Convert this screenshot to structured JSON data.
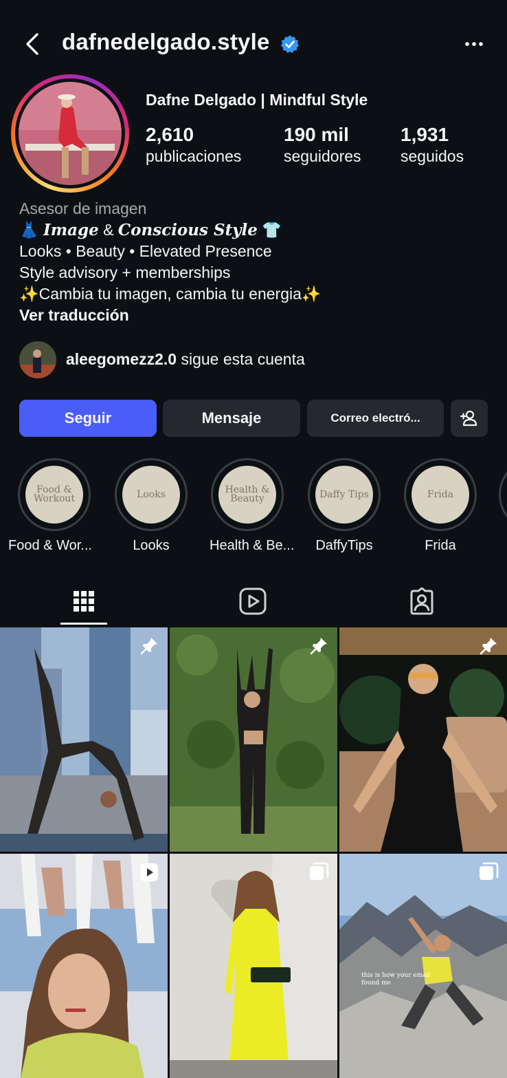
{
  "header": {
    "username": "dafnedelgado.style",
    "verified": true,
    "back_icon": "chevron-left-icon",
    "more_icon": "more-horizontal-icon"
  },
  "profile": {
    "display_name": "Dafne Delgado | Mindful Style",
    "stats": [
      {
        "value": "2,610",
        "label": "publicaciones"
      },
      {
        "value": "190 mil",
        "label": "seguidores"
      },
      {
        "value": "1,931",
        "label": "seguidos"
      }
    ]
  },
  "bio": {
    "category": "Asesor de imagen",
    "line1_emoji_left": "👗",
    "line1_word1": "Image",
    "line1_amp": " & ",
    "line1_word2": "Conscious Style",
    "line1_emoji_right": "👕",
    "line2": "Looks • Beauty • Elevated Presence",
    "line3": "Style advisory + memberships",
    "line4": "✨Cambia tu imagen, cambia tu energia✨",
    "translate": "Ver traducción"
  },
  "followed_by": {
    "username": "aleegomezz2.0",
    "suffix": " sigue esta cuenta"
  },
  "buttons": {
    "follow": "Seguir",
    "message": "Mensaje",
    "email": "Correo electró...",
    "add_user_icon": "add-person-icon"
  },
  "highlights": [
    {
      "cover_line1": "Food &",
      "cover_line2": "Workout",
      "label": "Food & Wor..."
    },
    {
      "cover_line1": "Looks",
      "cover_line2": "",
      "label": "Looks"
    },
    {
      "cover_line1": "Health &",
      "cover_line2": "Beauty",
      "label": "Health & Be..."
    },
    {
      "cover_line1": "Daffy Tips",
      "cover_line2": "",
      "label": "DaffyTips"
    },
    {
      "cover_line1": "Frida",
      "cover_line2": "",
      "label": "Frida"
    }
  ],
  "tabs": [
    {
      "icon": "grid-icon",
      "active": true
    },
    {
      "icon": "reels-icon",
      "active": false
    },
    {
      "icon": "tagged-icon",
      "active": false
    }
  ],
  "posts": [
    {
      "badge": "pin-icon",
      "scene": "yoga backbend on rooftop"
    },
    {
      "badge": "pin-icon",
      "scene": "woman posing in front of hedge"
    },
    {
      "badge": "pin-icon",
      "scene": "woman seated on couch at night"
    },
    {
      "badge": "reel-icon",
      "scene": "yoga class with speaker"
    },
    {
      "badge": "carousel-icon",
      "scene": "woman in yellow mesh dress"
    },
    {
      "badge": "carousel-icon",
      "scene": "yoga pose on mountain top",
      "caption": "this is how your email found me"
    }
  ],
  "colors": {
    "background": "#0c1014",
    "follow_button": "#4a5df9",
    "secondary_button": "#25292e",
    "verified_blue": "#3897f0",
    "muted_text": "#a8a8a8"
  }
}
